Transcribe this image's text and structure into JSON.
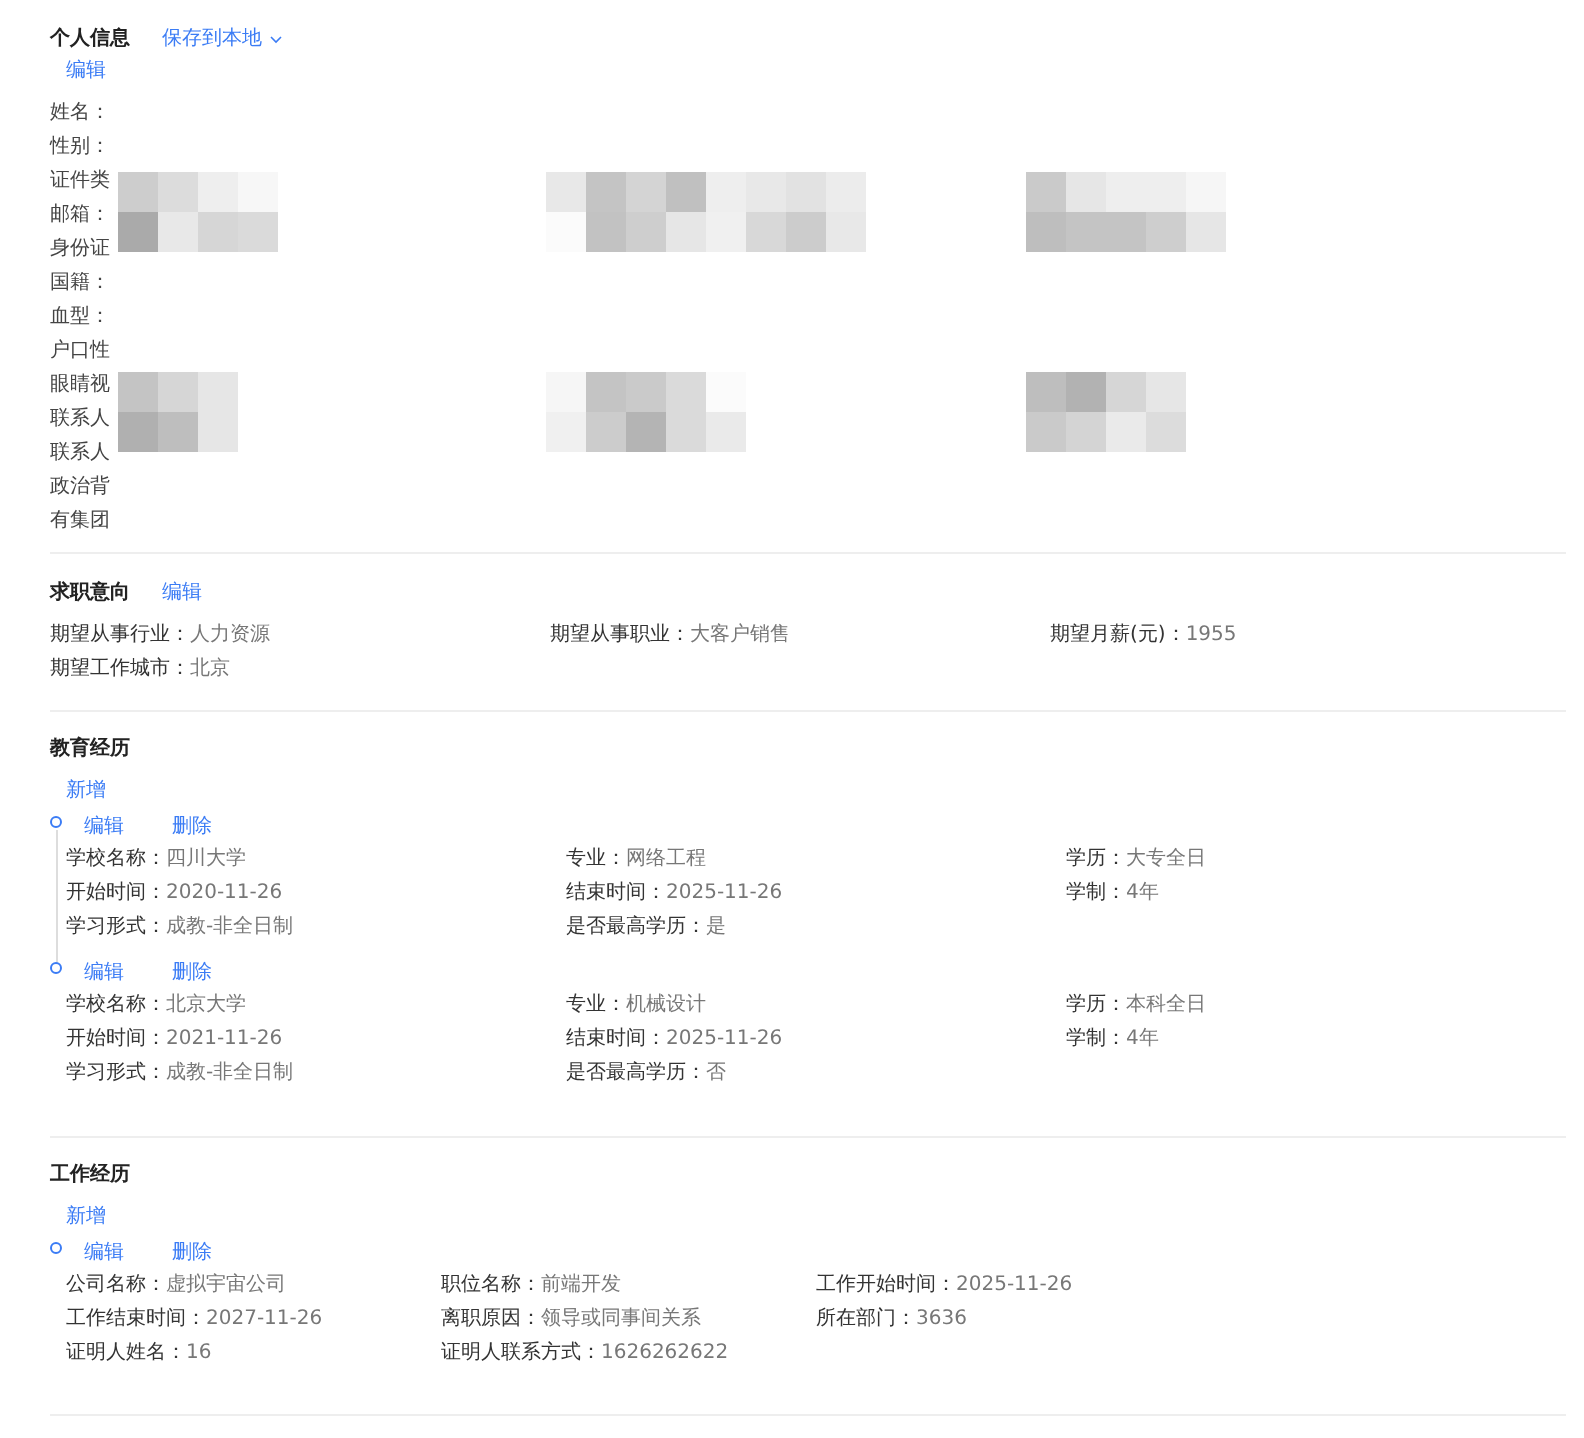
{
  "personal": {
    "title": "个人信息",
    "save_link": "保存到本地",
    "edit": "编辑",
    "fields": [
      "姓名：",
      "性别：",
      "证件类",
      "邮箱：",
      "身份证",
      "国籍：",
      "血型：",
      "户口性",
      "眼睛视",
      "联系人",
      "联系人",
      "政治背",
      "有集团"
    ]
  },
  "intent": {
    "title": "求职意向",
    "edit": "编辑",
    "fields": [
      {
        "label": "期望从事行业：",
        "value": "人力资源"
      },
      {
        "label": "期望从事职业：",
        "value": "大客户销售"
      },
      {
        "label": "期望月薪(元)：",
        "value": "1955"
      },
      {
        "label": "期望工作城市：",
        "value": "北京"
      }
    ]
  },
  "education": {
    "title": "教育经历",
    "add": "新增",
    "entries": [
      {
        "actions": [
          "编辑",
          "删除"
        ],
        "fields": [
          {
            "label": "学校名称：",
            "value": "四川大学"
          },
          {
            "label": "专业：",
            "value": "网络工程"
          },
          {
            "label": "学历：",
            "value": "大专全日"
          },
          {
            "label": "开始时间：",
            "value": "2020-11-26"
          },
          {
            "label": "结束时间：",
            "value": "2025-11-26"
          },
          {
            "label": "学制：",
            "value": "4年"
          },
          {
            "label": "学习形式：",
            "value": "成教-非全日制"
          },
          {
            "label": "是否最高学历：",
            "value": "是"
          }
        ]
      },
      {
        "actions": [
          "编辑",
          "删除"
        ],
        "fields": [
          {
            "label": "学校名称：",
            "value": "北京大学"
          },
          {
            "label": "专业：",
            "value": "机械设计"
          },
          {
            "label": "学历：",
            "value": "本科全日"
          },
          {
            "label": "开始时间：",
            "value": "2021-11-26"
          },
          {
            "label": "结束时间：",
            "value": "2025-11-26"
          },
          {
            "label": "学制：",
            "value": "4年"
          },
          {
            "label": "学习形式：",
            "value": "成教-非全日制"
          },
          {
            "label": "是否最高学历：",
            "value": "否"
          }
        ]
      }
    ]
  },
  "work": {
    "title": "工作经历",
    "add": "新增",
    "entries": [
      {
        "actions": [
          "编辑",
          "删除"
        ],
        "fields": [
          {
            "label": "公司名称：",
            "value": "虚拟宇宙公司"
          },
          {
            "label": "职位名称：",
            "value": "前端开发"
          },
          {
            "label": "工作开始时间：",
            "value": "2025-11-26"
          },
          {
            "label": "工作结束时间：",
            "value": "2027-11-26"
          },
          {
            "label": "离职原因：",
            "value": "领导或同事间关系"
          },
          {
            "label": "所在部门：",
            "value": "3636"
          },
          {
            "label": "证明人姓名：",
            "value": "16"
          },
          {
            "label": "证明人联系方式：",
            "value": "1626262622"
          }
        ]
      }
    ]
  }
}
